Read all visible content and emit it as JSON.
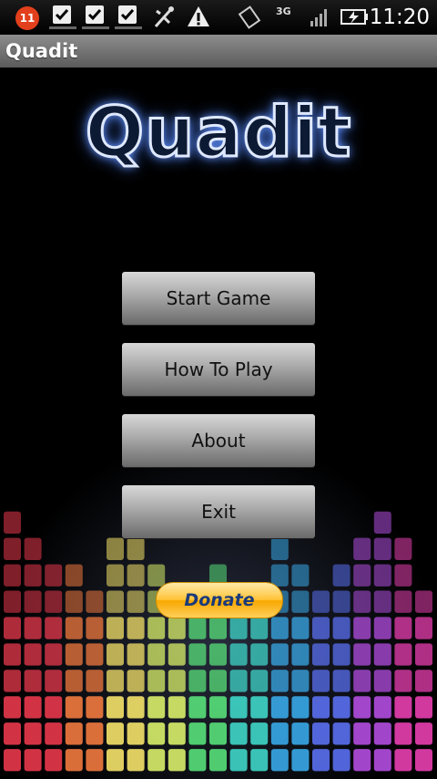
{
  "status_bar": {
    "notification_count": "11",
    "network": "3G",
    "time": "11:20",
    "icons": [
      "notification-badge-icon",
      "task-done-icon",
      "task-done-icon",
      "task-done-icon",
      "usb-icon",
      "warning-icon",
      "rotate-icon",
      "network-3g-icon",
      "signal-icon",
      "battery-charging-icon"
    ]
  },
  "title_bar": {
    "title": "Quadit"
  },
  "logo": {
    "text": "Quadit"
  },
  "menu": {
    "start_game": "Start Game",
    "how_to_play": "How To Play",
    "about": "About",
    "exit": "Exit"
  },
  "donate": {
    "label": "Donate"
  },
  "colors": {
    "title_bar": "#7a7a7a",
    "button_top": "#d8d8d8",
    "button_bottom": "#6a6a6a",
    "donate": "#ffc43a",
    "block_palette": [
      "#e8394d",
      "#f27a3f",
      "#f5e36a",
      "#d9f06a",
      "#58e07a",
      "#3fd6c8",
      "#39a9e8",
      "#5a6ff0",
      "#b34ee0",
      "#e83fb0"
    ]
  }
}
